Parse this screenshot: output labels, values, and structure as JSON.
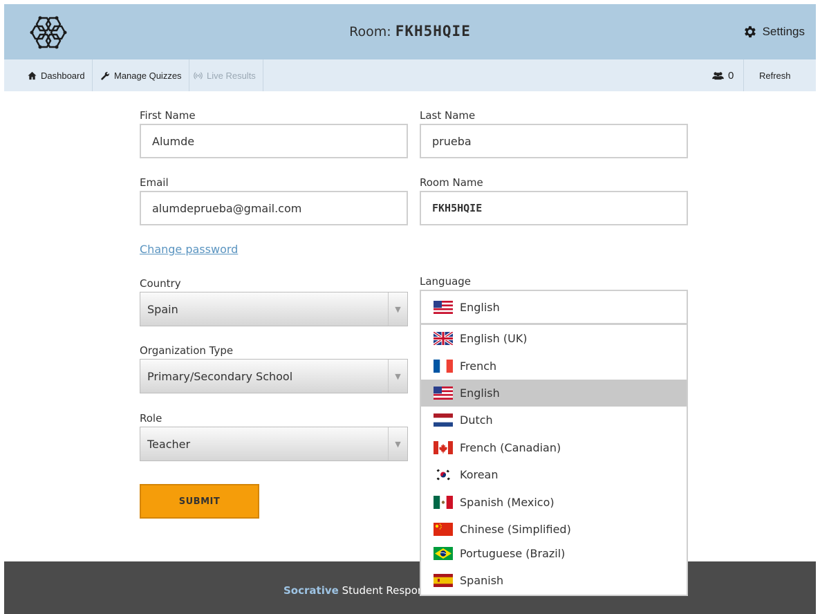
{
  "header": {
    "room_label": "Room:",
    "room_code": "FKH5HQIE",
    "settings_label": "Settings"
  },
  "nav": {
    "dashboard": "Dashboard",
    "manage_quizzes": "Manage Quizzes",
    "live_results": "Live Results",
    "student_count": "0",
    "refresh": "Refresh"
  },
  "form": {
    "first_name_label": "First Name",
    "first_name_value": "Alumde",
    "last_name_label": "Last Name",
    "last_name_value": "prueba",
    "email_label": "Email",
    "email_value": "alumdeprueba@gmail.com",
    "room_name_label": "Room Name",
    "room_name_value": "FKH5HQIE",
    "change_password": "Change password",
    "country_label": "Country",
    "country_value": "Spain",
    "org_type_label": "Organization Type",
    "org_type_value": "Primary/Secondary School",
    "role_label": "Role",
    "role_value": "Teacher",
    "language_label": "Language",
    "language_value": "English",
    "submit": "SUBMIT"
  },
  "languages": [
    {
      "label": "English (UK)",
      "flag": "uk-flag"
    },
    {
      "label": "French",
      "flag": "france-flag"
    },
    {
      "label": "English",
      "flag": "us-flag",
      "selected": true
    },
    {
      "label": "Dutch",
      "flag": "netherlands-flag"
    },
    {
      "label": "French (Canadian)",
      "flag": "canada-flag"
    },
    {
      "label": "Korean",
      "flag": "korea-flag"
    },
    {
      "label": "Spanish (Mexico)",
      "flag": "mexico-flag"
    },
    {
      "label": "Chinese (Simplified)",
      "flag": "china-flag"
    },
    {
      "label": "Portuguese (Brazil)",
      "flag": "brazil-flag"
    },
    {
      "label": "Spanish",
      "flag": "spain-flag"
    }
  ],
  "footer": {
    "brand": "Socrative",
    "text": "Student Respor"
  },
  "colors": {
    "header_bg": "#aecbe0",
    "subnav_bg": "#e1ebf4",
    "submit_bg": "#f59d0a",
    "link": "#5a94c0",
    "footer_bg": "#4b4b4b"
  }
}
